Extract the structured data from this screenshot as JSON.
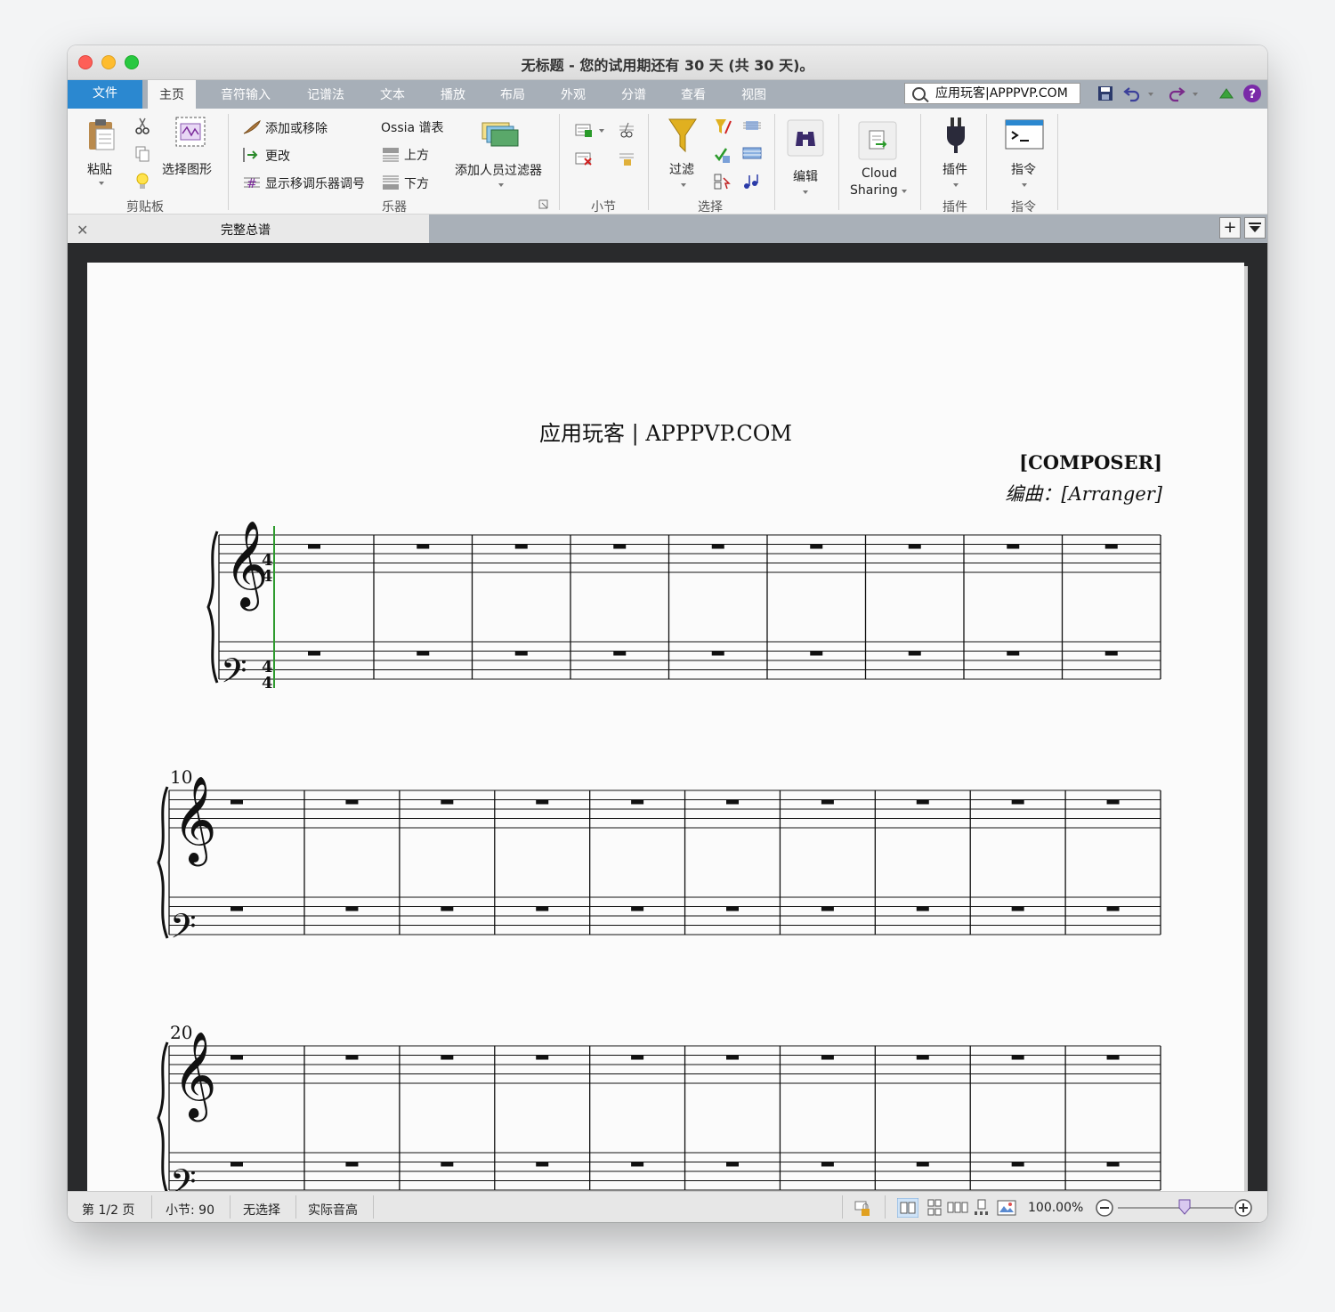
{
  "window": {
    "title": "无标题 - 您的试用期还有 30 天 (共 30 天)。"
  },
  "tabs": [
    {
      "label": "文件"
    },
    {
      "label": "主页"
    },
    {
      "label": "音符输入"
    },
    {
      "label": "记谱法"
    },
    {
      "label": "文本"
    },
    {
      "label": "播放"
    },
    {
      "label": "布局"
    },
    {
      "label": "外观"
    },
    {
      "label": "分谱"
    },
    {
      "label": "查看"
    },
    {
      "label": "视图"
    }
  ],
  "search": {
    "value": "应用玩客|APPPVP.COM"
  },
  "ribbon": {
    "clipboard": {
      "paste": "粘贴",
      "select_graphic": "选择图形",
      "group": "剪贴板"
    },
    "instruments": {
      "add_remove": "添加或移除",
      "change": "更改",
      "transposing": "显示移调乐器调号",
      "ossia": "Ossia 谱表",
      "above": "上方",
      "below": "下方",
      "player_filter": "添加人员过滤器",
      "group": "乐器"
    },
    "bars": {
      "group": "小节"
    },
    "select": {
      "filter": "过滤",
      "group": "选择"
    },
    "edit": {
      "label": "编辑"
    },
    "cloud": {
      "line1": "Cloud",
      "line2": "Sharing"
    },
    "plugins": {
      "label": "插件",
      "group": "插件"
    },
    "command": {
      "label": "指令",
      "group": "指令"
    }
  },
  "document": {
    "tab_title": "完整总谱"
  },
  "score": {
    "title": "应用玩客 | APPPVP.COM",
    "composer": "[COMPOSER]",
    "arranger": "编曲：[Arranger]",
    "time_signature": {
      "numerator": "4",
      "denominator": "4"
    },
    "systems": [
      {
        "measure_number": "",
        "bars": 9
      },
      {
        "measure_number": "10",
        "bars": 10
      },
      {
        "measure_number": "20",
        "bars": 10
      }
    ]
  },
  "status": {
    "page": "第 1/2 页",
    "bar": "小节: 90",
    "selection": "无选择",
    "pitch": "实际音高",
    "zoom": "100.00%",
    "zoom_level": 0.58
  },
  "colors": {
    "file_tab": "#2b88d0",
    "tabbar": "#a7afb8",
    "canvas": "#292a2c",
    "playline": "#2e9b2e"
  }
}
